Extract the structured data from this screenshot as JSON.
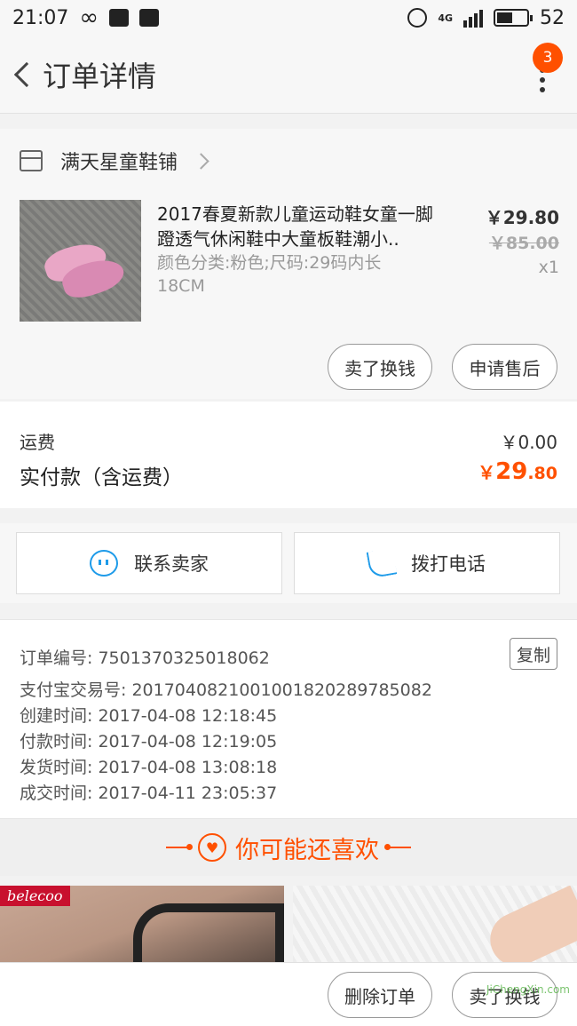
{
  "status_bar": {
    "time": "21:07",
    "network": "4G",
    "battery": "52"
  },
  "nav": {
    "title": "订单详情",
    "badge": "3"
  },
  "shop": {
    "name": "满天星童鞋铺"
  },
  "product": {
    "title": "2017春夏新款儿童运动鞋女童一脚蹬透气休闲鞋中大童板鞋潮小..",
    "sku": "颜色分类:粉色;尺码:29码内长18CM",
    "price": "￥29.80",
    "original_price": "￥85.00",
    "quantity": "x1",
    "actions": [
      "卖了换钱",
      "申请售后"
    ]
  },
  "fee": {
    "shipping_label": "运费",
    "shipping_value": "￥0.00",
    "paid_label": "实付款（含运费）",
    "paid_currency": "￥",
    "paid_int": "29",
    "paid_dec": ".80"
  },
  "contact": {
    "seller": "联系卖家",
    "phone": "拨打电话"
  },
  "order_info": {
    "order_no": "订单编号: 7501370325018062",
    "copy": "复制",
    "alipay_no": "支付宝交易号: 2017040821001001820289785082",
    "created": "创建时间: 2017-04-08 12:18:45",
    "paid": "付款时间: 2017-04-08 12:19:05",
    "shipped": "发货时间: 2017-04-08 13:08:18",
    "completed": "成交时间: 2017-04-11 23:05:37"
  },
  "recommend": {
    "title": "你可能还喜欢",
    "brand": "belecoo"
  },
  "bottom": {
    "delete": "删除订单",
    "resell": "卖了换钱"
  },
  "watermark": "JiChengXin.com",
  "colors": {
    "accent": "#ff5000",
    "icon_blue": "#1e9be9"
  }
}
